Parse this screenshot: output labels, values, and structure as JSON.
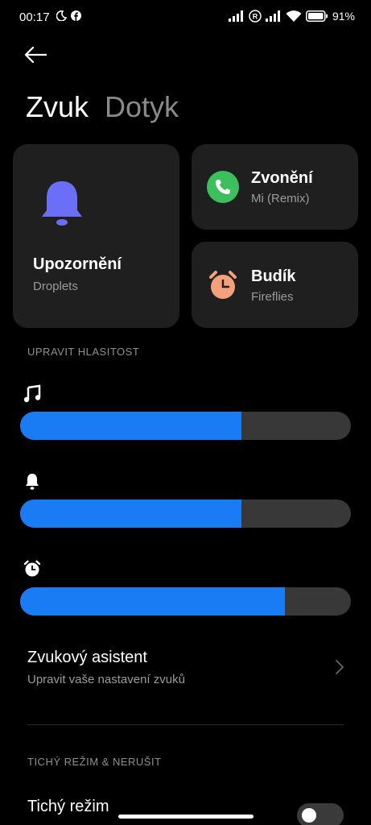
{
  "status_bar": {
    "time": "00:17",
    "battery": "91%",
    "icons": [
      "moon-icon",
      "facebook-icon",
      "signal-icon",
      "roaming-icon",
      "signal-icon",
      "wifi-icon",
      "battery-icon"
    ]
  },
  "header": {
    "back_icon": "arrow-left-icon",
    "tabs": [
      {
        "label": "Zvuk",
        "active": true
      },
      {
        "label": "Dotyk",
        "active": false
      }
    ]
  },
  "cards": {
    "notifications": {
      "title": "Upozornění",
      "subtitle": "Droplets",
      "icon": "bell-icon",
      "color": "#6b6ef7"
    },
    "ringtone": {
      "title": "Zvonění",
      "subtitle": "Mi (Remix)",
      "icon": "phone-icon",
      "color": "#3dbf5e"
    },
    "alarm": {
      "title": "Budík",
      "subtitle": "Fireflies",
      "icon": "alarm-clock-icon",
      "color": "#f4a07a"
    }
  },
  "volume": {
    "section_label": "UPRAVIT HLASITOST",
    "accent": "#1a7cf5",
    "sliders": [
      {
        "name": "media",
        "icon": "music-note-icon",
        "level": 0.67
      },
      {
        "name": "notification",
        "icon": "bell-icon",
        "level": 0.67
      },
      {
        "name": "alarm",
        "icon": "alarm-clock-icon",
        "level": 0.8
      }
    ]
  },
  "sound_assistant": {
    "title": "Zvukový asistent",
    "subtitle": "Upravit vaše nastavení zvuků",
    "icon": "chevron-right-icon"
  },
  "silent_section": {
    "section_label": "TICHÝ REŽIM & NERUŠIT",
    "silent_mode": {
      "title": "Tichý režim",
      "enabled": false
    }
  }
}
